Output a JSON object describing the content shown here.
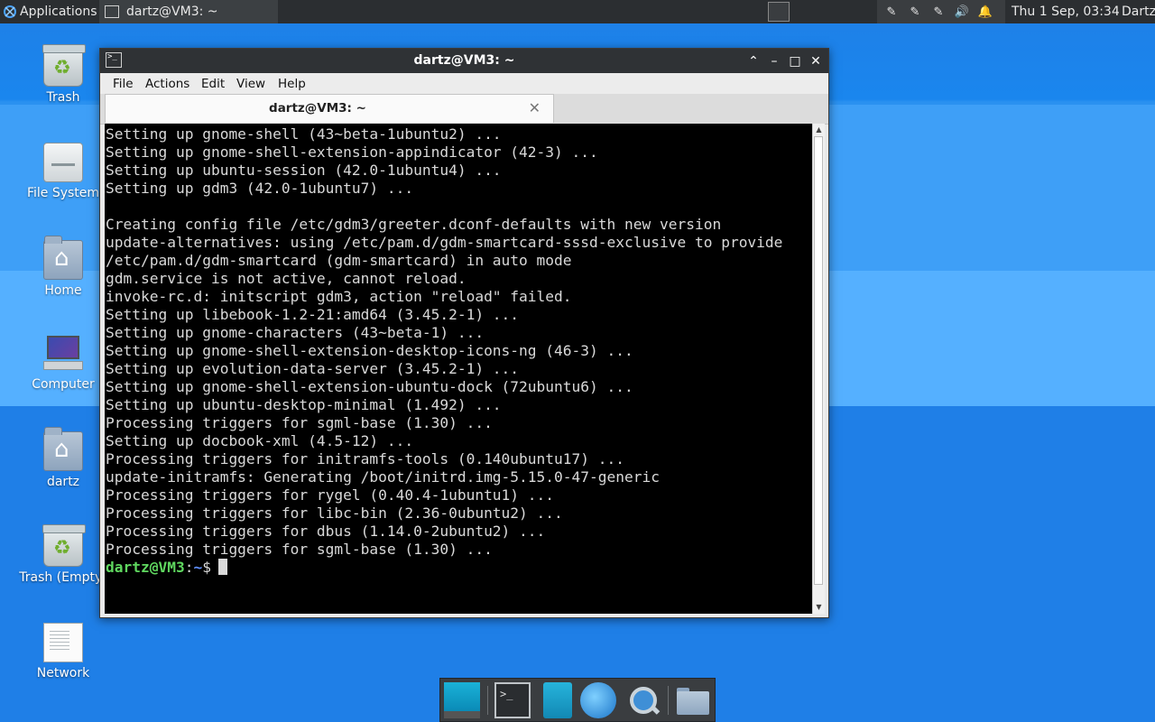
{
  "top_panel": {
    "applications_label": "Applications",
    "task_title": "dartz@VM3: ~",
    "clock": "Thu  1 Sep, 03:34",
    "user": "Dartz"
  },
  "desktop_icons": [
    {
      "label": "Trash"
    },
    {
      "label": "File System"
    },
    {
      "label": "Home"
    },
    {
      "label": "Computer"
    },
    {
      "label": "dartz"
    },
    {
      "label": "Trash (Empty)"
    },
    {
      "label": "Network"
    }
  ],
  "window": {
    "title": "dartz@VM3: ~",
    "menu": [
      "File",
      "Actions",
      "Edit",
      "View",
      "Help"
    ],
    "tab_title": "dartz@VM3: ~",
    "tab_close": "✕"
  },
  "terminal": {
    "lines": [
      "Setting up gnome-shell (43~beta-1ubuntu2) ...",
      "Setting up gnome-shell-extension-appindicator (42-3) ...",
      "Setting up ubuntu-session (42.0-1ubuntu4) ...",
      "Setting up gdm3 (42.0-1ubuntu7) ...",
      "",
      "Creating config file /etc/gdm3/greeter.dconf-defaults with new version",
      "update-alternatives: using /etc/pam.d/gdm-smartcard-sssd-exclusive to provide",
      "/etc/pam.d/gdm-smartcard (gdm-smartcard) in auto mode",
      "gdm.service is not active, cannot reload.",
      "invoke-rc.d: initscript gdm3, action \"reload\" failed.",
      "Setting up libebook-1.2-21:amd64 (3.45.2-1) ...",
      "Setting up gnome-characters (43~beta-1) ...",
      "Setting up gnome-shell-extension-desktop-icons-ng (46-3) ...",
      "Setting up evolution-data-server (3.45.2-1) ...",
      "Setting up gnome-shell-extension-ubuntu-dock (72ubuntu6) ...",
      "Setting up ubuntu-desktop-minimal (1.492) ...",
      "Processing triggers for sgml-base (1.30) ...",
      "Setting up docbook-xml (4.5-12) ...",
      "Processing triggers for initramfs-tools (0.140ubuntu17) ...",
      "update-initramfs: Generating /boot/initrd.img-5.15.0-47-generic",
      "Processing triggers for rygel (0.40.4-1ubuntu1) ...",
      "Processing triggers for libc-bin (2.36-0ubuntu2) ...",
      "Processing triggers for dbus (1.14.0-2ubuntu2) ...",
      "Processing triggers for sgml-base (1.30) ..."
    ],
    "prompt_user": "dartz@VM3",
    "prompt_sep": ":",
    "prompt_path": "~",
    "prompt_symbol": "$"
  },
  "colors": {
    "prompt_user": "#5fd75f",
    "prompt_path": "#5f8fff",
    "desktop_bg": "#1f7fe7",
    "panel_bg": "#2b2e31"
  }
}
